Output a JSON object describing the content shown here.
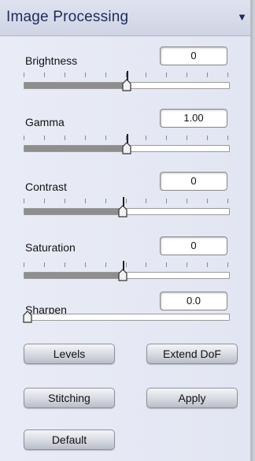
{
  "header": {
    "title": "Image Processing",
    "collapse_icon": "triangle-down-icon"
  },
  "sliders": [
    {
      "id": "brightness",
      "label": "Brightness",
      "value": "0",
      "position": 0.5,
      "center": 0.5
    },
    {
      "id": "gamma",
      "label": "Gamma",
      "value": "1.00",
      "position": 0.5,
      "center": 0.5
    },
    {
      "id": "contrast",
      "label": "Contrast",
      "value": "0",
      "position": 0.48,
      "center": 0.48
    },
    {
      "id": "saturation",
      "label": "Saturation",
      "value": "0",
      "position": 0.48,
      "center": 0.48
    },
    {
      "id": "sharpen",
      "label": "Sharpen",
      "value": "0.0",
      "position": 0.0,
      "center": null
    }
  ],
  "buttons": {
    "levels": "Levels",
    "extend_dof": "Extend DoF",
    "stitching": "Stitching",
    "apply": "Apply",
    "default": "Default"
  }
}
